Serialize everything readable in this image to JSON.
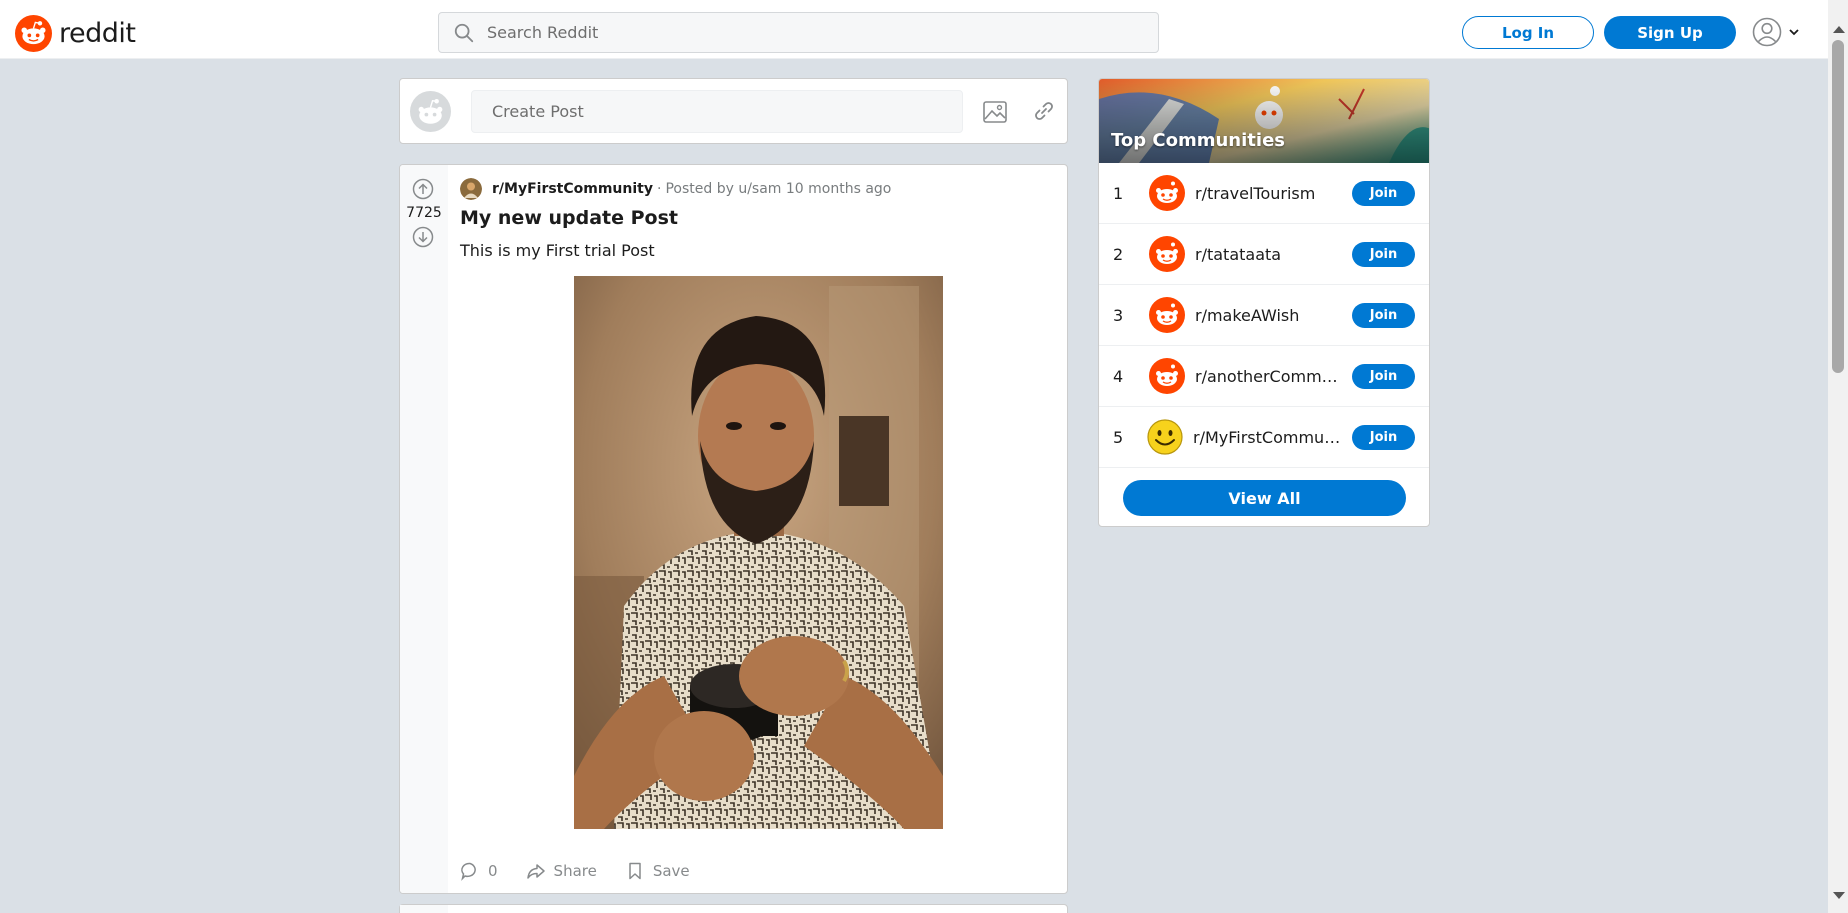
{
  "header": {
    "logo_text": "reddit",
    "search_placeholder": "Search Reddit",
    "login_label": "Log In",
    "signup_label": "Sign Up",
    "icons": [
      "reddit-logo-icon",
      "search-icon",
      "user-icon",
      "chevron-down-icon"
    ]
  },
  "create_post": {
    "placeholder": "Create Post",
    "icons": [
      "snoo-avatar-icon",
      "image-icon",
      "link-icon"
    ]
  },
  "post": {
    "votes": "7725",
    "subreddit": "r/MyFirstCommunity",
    "separator": "·",
    "posted_by": "Posted by u/sam 10 months ago",
    "title": "My new update Post",
    "body": "This is my First trial Post",
    "comments_count": "0",
    "share_label": "Share",
    "save_label": "Save",
    "icons": [
      "upvote-icon",
      "downvote-icon",
      "comment-icon",
      "share-icon",
      "save-icon"
    ]
  },
  "sidebar": {
    "title": "Top Communities",
    "communities": [
      {
        "rank": "1",
        "name": "r/travelTourism",
        "join": "Join",
        "icon": "snoo-icon"
      },
      {
        "rank": "2",
        "name": "r/tatataata",
        "join": "Join",
        "icon": "snoo-icon"
      },
      {
        "rank": "3",
        "name": "r/makeAWish",
        "join": "Join",
        "icon": "snoo-icon"
      },
      {
        "rank": "4",
        "name": "r/anotherCommunity",
        "join": "Join",
        "icon": "snoo-icon"
      },
      {
        "rank": "5",
        "name": "r/MyFirstCommunity",
        "join": "Join",
        "icon": "smiley-icon"
      }
    ],
    "view_all_label": "View All"
  },
  "colors": {
    "brand": "#ff4500",
    "accent": "#0079d3",
    "background": "#dae0e6"
  }
}
